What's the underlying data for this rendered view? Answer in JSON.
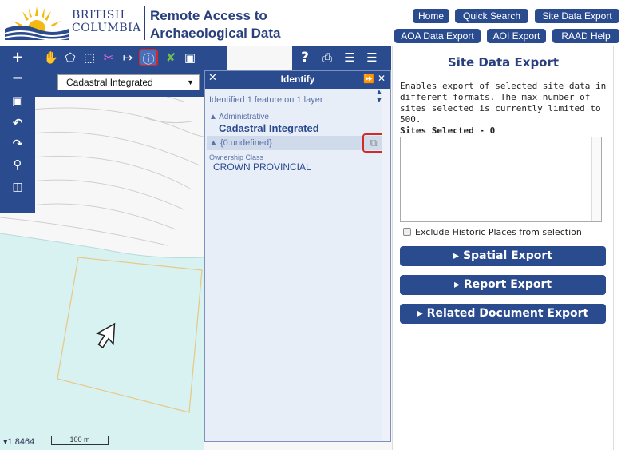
{
  "header": {
    "org_line1": "British",
    "org_line2": "Columbia",
    "app_title_line1": "Remote Access to",
    "app_title_line2": "Archaeological Data",
    "nav_row1": [
      "Home",
      "Quick Search",
      "Site Data Export"
    ],
    "nav_row2": [
      "AOA Data Export",
      "AOI Export",
      "RAAD Help"
    ]
  },
  "map": {
    "layer_select_value": "Cadastral Integrated",
    "scale_text": "1:8464",
    "scale_bar_label": "100 m",
    "left_tools": [
      "plus-icon",
      "minus-icon",
      "zoom-extent-icon",
      "back-icon",
      "forward-icon",
      "search-icon",
      "book-icon"
    ],
    "top_tools": [
      "pan-icon",
      "polygon-icon",
      "rectangle-select-icon",
      "eraser-icon",
      "measure-icon",
      "identify-icon",
      "clear-icon",
      "save-icon"
    ],
    "top_right_tools": [
      "help-icon",
      "print-icon",
      "legend-icon",
      "layers-icon"
    ],
    "accent_color": "#2b4b8f",
    "highlight_color": "#d12a2a"
  },
  "identify": {
    "title": "Identify",
    "summary": "Identified 1 feature on 1 layer",
    "group_label": "Administrative",
    "layer_name": "Cadastral Integrated",
    "feature_label": "{0:undefined}",
    "field_label": "Ownership Class",
    "field_value": "CROWN PROVINCIAL"
  },
  "export_panel": {
    "title": "Site Data Export",
    "description": "Enables export of selected site data in different formats. The max number of sites selected is currently limited to 500.",
    "sites_selected_label": "Sites Selected - 0",
    "exclude_label": "Exclude Historic Places from selection",
    "buttons": [
      "Spatial Export",
      "Report Export",
      "Related Document Export"
    ]
  }
}
